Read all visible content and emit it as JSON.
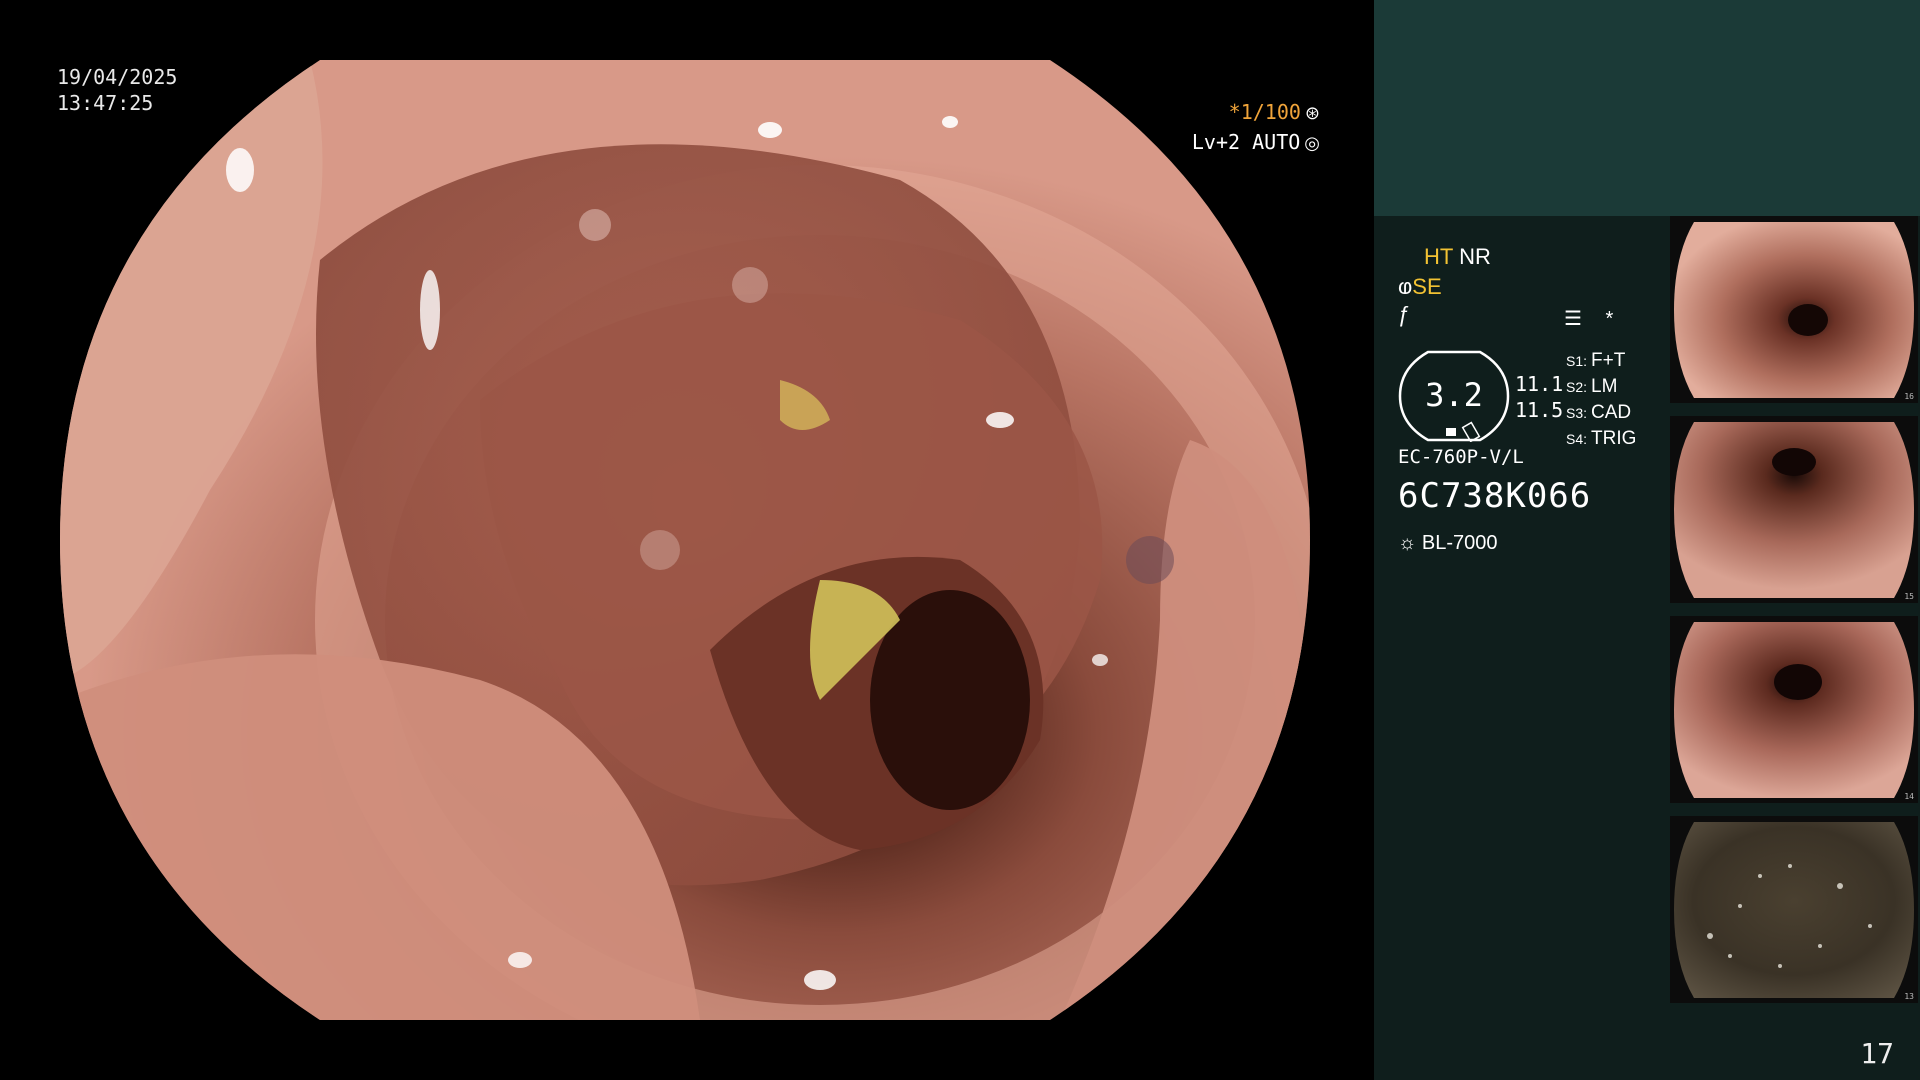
{
  "overlay": {
    "date": "19/04/2025",
    "time": "13:47:25",
    "shutter": "*1/100",
    "level": "Lv+2",
    "auto": "AUTO"
  },
  "settings": {
    "ht": "HT",
    "nr": "NR",
    "se": "SE",
    "ring_value": "3.2",
    "values": [
      "11.1",
      "11.5"
    ],
    "switches": [
      {
        "key": "S1:",
        "value": "F+T"
      },
      {
        "key": "S2:",
        "value": "LM"
      },
      {
        "key": "S3:",
        "value": "CAD"
      },
      {
        "key": "S4:",
        "value": "TRIG"
      }
    ],
    "scope_model": "EC-760P-V/L",
    "scope_serial": "6C738K066",
    "light_source": "BL-7000"
  },
  "thumbnails": [
    {
      "label": "16"
    },
    {
      "label": "15"
    },
    {
      "label": "14"
    },
    {
      "label": "13"
    }
  ],
  "page_number": "17",
  "icons": [
    "aperture-icon",
    "iris-icon",
    "se-icon",
    "f-icon",
    "menu-icon",
    "asterisk-icon",
    "lamp-icon"
  ],
  "colors": {
    "accent_orange": "#f0a43a",
    "accent_yellow": "#f2c233",
    "panel_top": "#1b3a37",
    "panel_bottom": "#0f1e1c"
  }
}
